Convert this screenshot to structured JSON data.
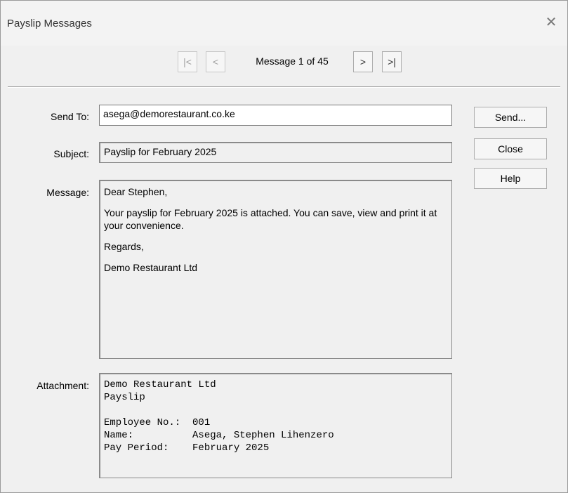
{
  "window": {
    "title": "Payslip Messages",
    "close_glyph": "✕"
  },
  "navigation": {
    "first_glyph": "|<",
    "prev_glyph": "<",
    "status": "Message 1 of 45",
    "next_glyph": ">",
    "last_glyph": ">|"
  },
  "form": {
    "send_to_label": "Send To:",
    "send_to_value": "asega@demorestaurant.co.ke",
    "subject_label": "Subject:",
    "subject_value": "Payslip for February 2025",
    "message_label": "Message:",
    "message_lines": [
      "Dear Stephen,",
      "Your payslip for February 2025 is attached. You can save, view and print it at your convenience.",
      "Regards,",
      "Demo Restaurant Ltd"
    ],
    "attachment_label": "Attachment:",
    "attachment_lines": [
      "Demo Restaurant Ltd",
      "Payslip",
      "",
      "Employee No.:  001",
      "Name:          Asega, Stephen Lihenzero",
      "Pay Period:    February 2025"
    ]
  },
  "buttons": {
    "send": "Send...",
    "close": "Close",
    "help": "Help"
  }
}
